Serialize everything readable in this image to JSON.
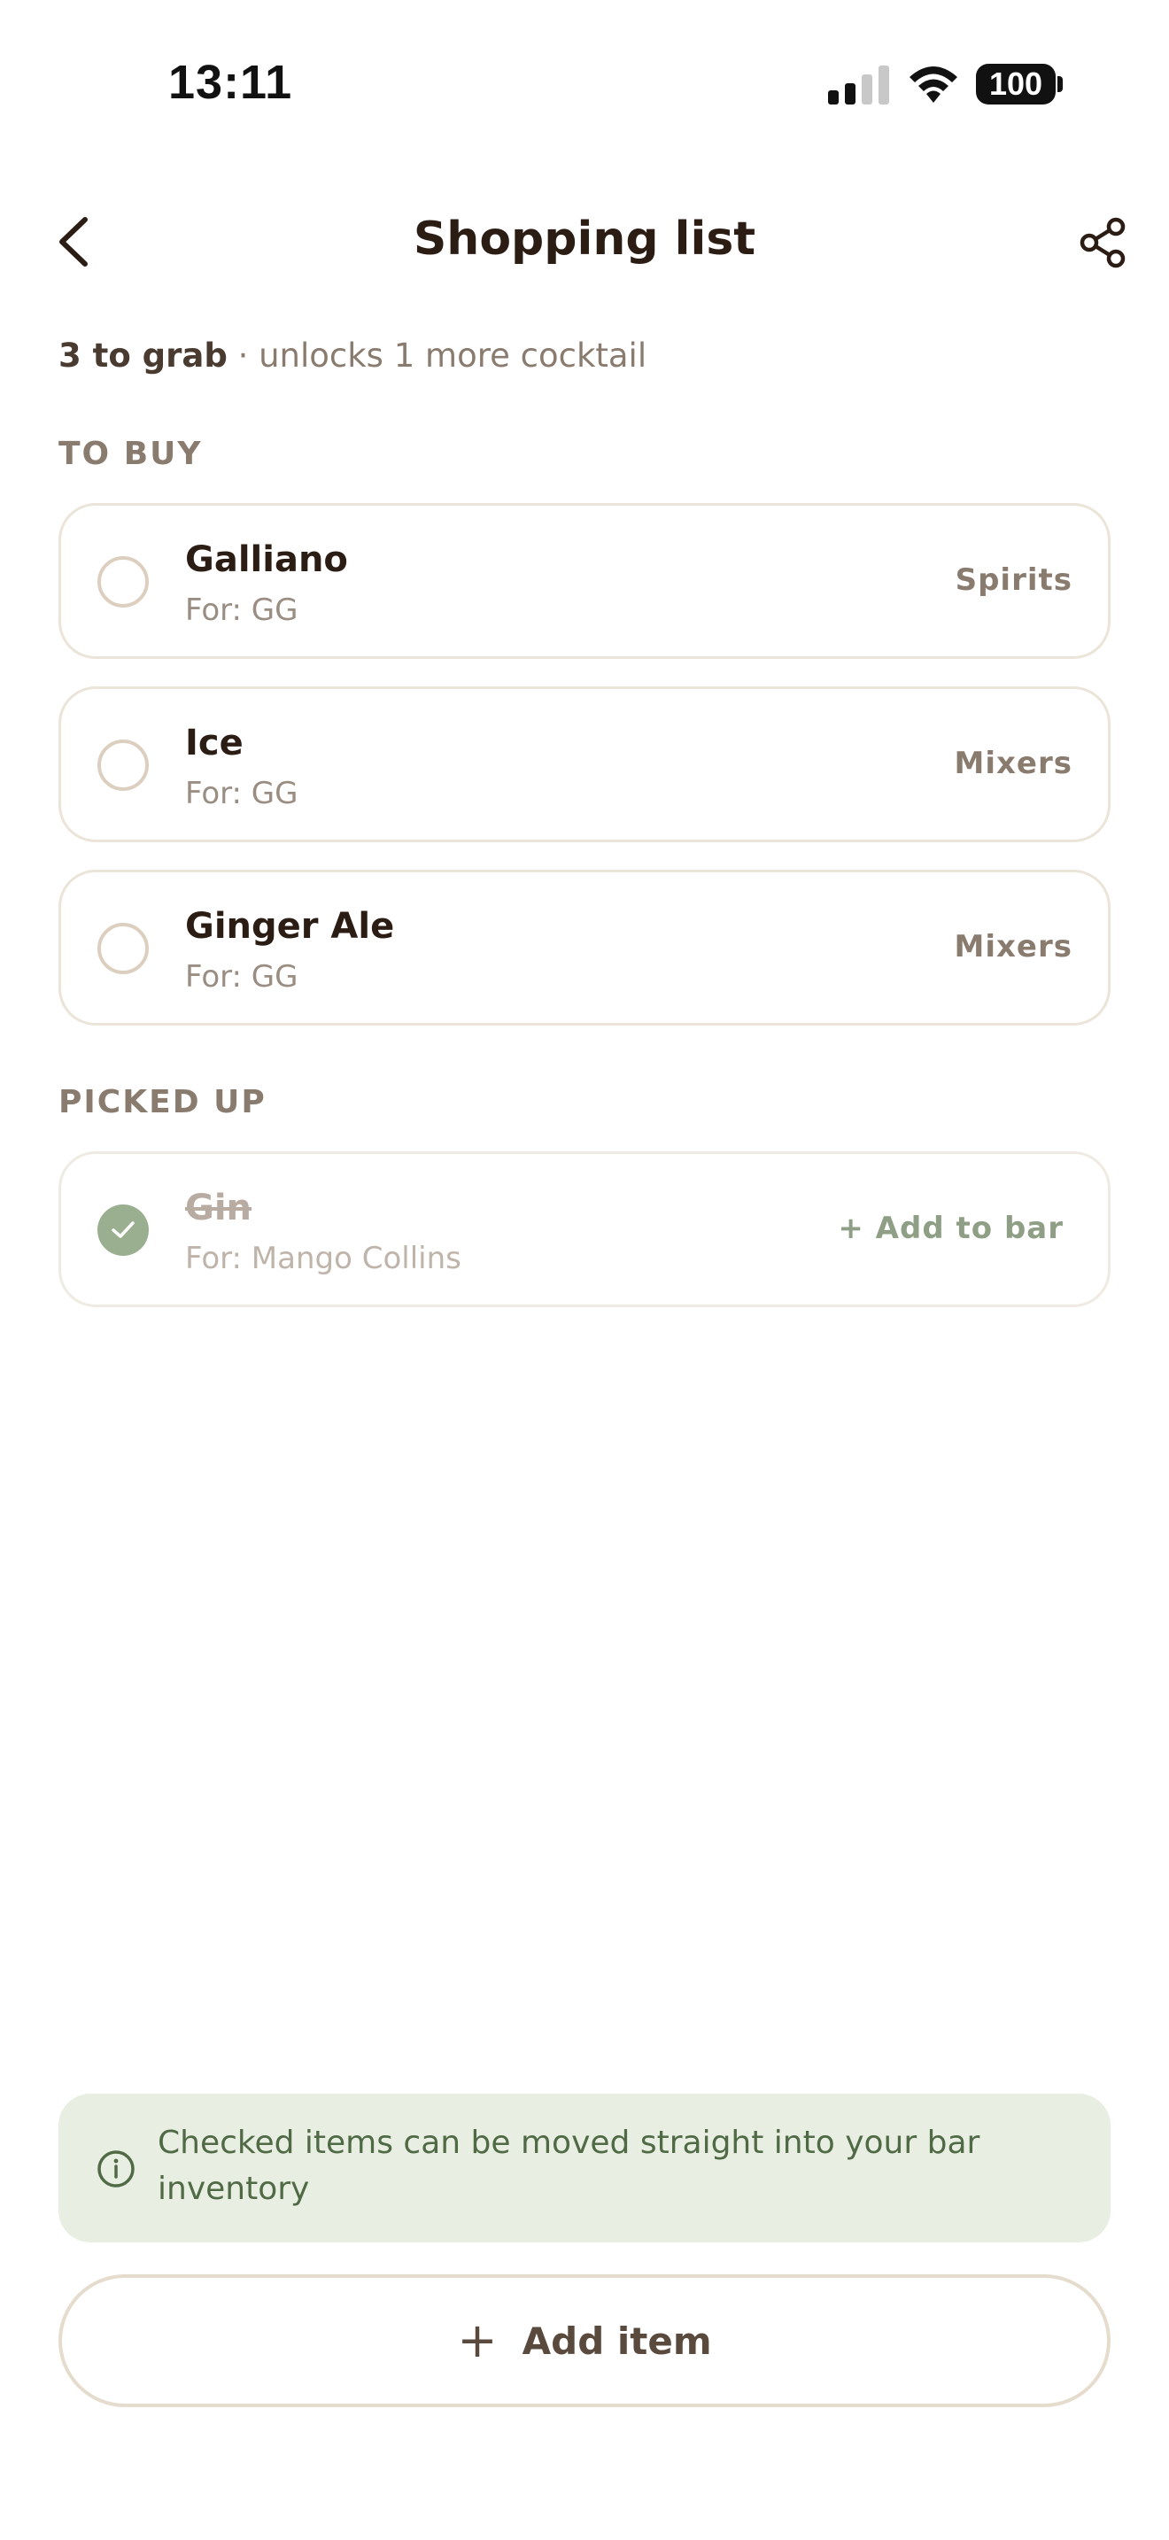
{
  "status_bar": {
    "time": "13:11",
    "battery": "100"
  },
  "nav": {
    "title": "Shopping list",
    "back_icon": "chevron-left-icon",
    "share_icon": "share-icon"
  },
  "summary": {
    "count_text": "3 to grab",
    "detail_text": " · unlocks 1 more cocktail"
  },
  "sections": {
    "to_buy_label": "TO BUY",
    "picked_up_label": "PICKED UP"
  },
  "to_buy": [
    {
      "name": "Galliano",
      "for": "For: GG",
      "category": "Spirits"
    },
    {
      "name": "Ice",
      "for": "For: GG",
      "category": "Mixers"
    },
    {
      "name": "Ginger Ale",
      "for": "For: GG",
      "category": "Mixers"
    }
  ],
  "picked_up": [
    {
      "name": "Gin",
      "for": "For: Mango Collins",
      "action": "+ Add to bar"
    }
  ],
  "info": {
    "text": "Checked items can be moved straight into your bar inventory"
  },
  "add_item": {
    "plus": "+",
    "label": "Add item"
  },
  "colors": {
    "accent_green": "#9aae90",
    "info_bg": "#e8efe2",
    "text_dark": "#2b1d14"
  }
}
